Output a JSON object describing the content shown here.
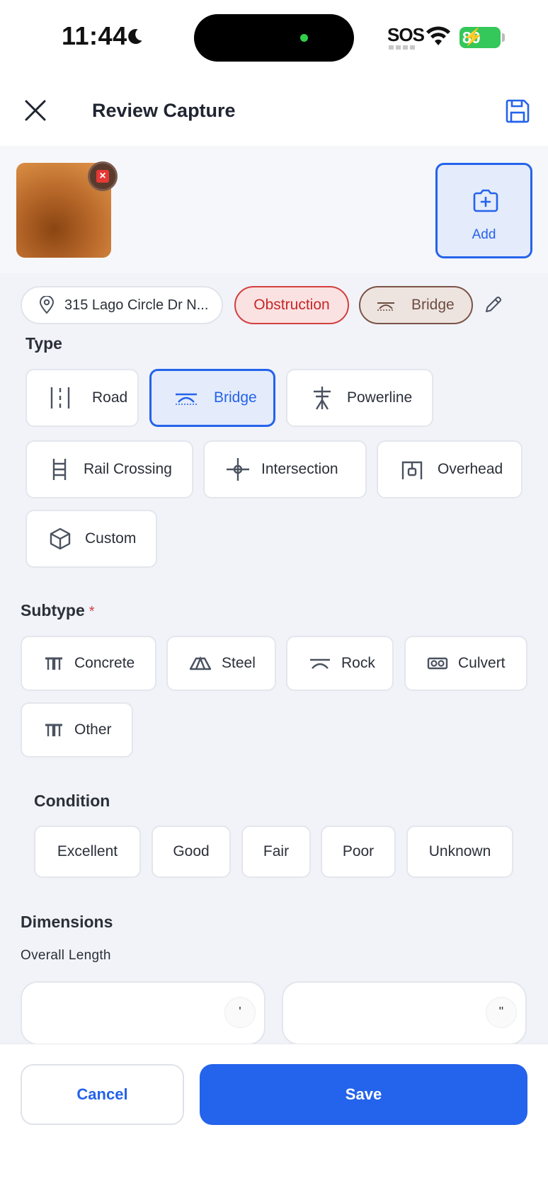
{
  "status_bar": {
    "time": "11:44",
    "carrier": "SOS",
    "battery": "80",
    "moon_icon": "moon-icon",
    "wifi_icon": "wifi-icon"
  },
  "header": {
    "title": "Review Capture",
    "close_icon": "close-icon",
    "save_icon": "save-icon"
  },
  "photos": {
    "add_label": "Add",
    "remove_icon": "remove-photo-icon",
    "add_icon": "camera-plus-icon"
  },
  "chips": {
    "address": "315 Lago Circle Dr N...",
    "category": "Obstruction",
    "type": "Bridge"
  },
  "type_section": {
    "title": "Type",
    "options": [
      {
        "label": "Road",
        "icon": "road-icon",
        "selected": false
      },
      {
        "label": "Bridge",
        "icon": "bridge-icon",
        "selected": true
      },
      {
        "label": "Powerline",
        "icon": "powerline-icon",
        "selected": false
      },
      {
        "label": "Rail Crossing",
        "icon": "rail-crossing-icon",
        "selected": false
      },
      {
        "label": "Intersection",
        "icon": "intersection-icon",
        "selected": false
      },
      {
        "label": "Overhead",
        "icon": "overhead-icon",
        "selected": false
      },
      {
        "label": "Custom",
        "icon": "cube-icon",
        "selected": false
      }
    ]
  },
  "subtype_section": {
    "title": "Subtype",
    "required_mark": "*",
    "options": [
      {
        "label": "Concrete",
        "icon": "concrete-icon"
      },
      {
        "label": "Steel",
        "icon": "steel-icon"
      },
      {
        "label": "Rock",
        "icon": "rock-bridge-icon"
      },
      {
        "label": "Culvert",
        "icon": "culvert-icon"
      },
      {
        "label": "Other",
        "icon": "other-icon"
      }
    ]
  },
  "condition_section": {
    "title": "Condition",
    "options": [
      "Excellent",
      "Good",
      "Fair",
      "Poor",
      "Unknown"
    ]
  },
  "dimensions": {
    "title": "Dimensions",
    "overall_length_label": "Overall Length",
    "feet_unit": "'",
    "inches_unit": "\""
  },
  "footer": {
    "cancel_label": "Cancel",
    "save_label": "Save"
  },
  "colors": {
    "accent": "#2463eb",
    "danger": "#d33f3f",
    "bridge_brown": "#6d4c41",
    "background": "#f1f3f8"
  }
}
